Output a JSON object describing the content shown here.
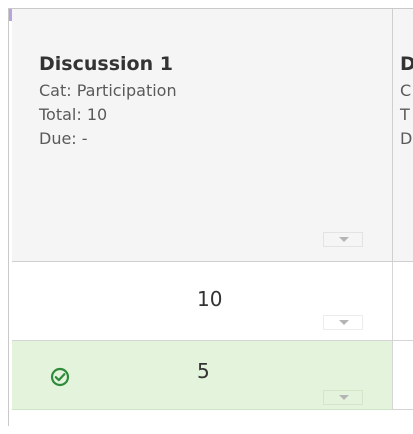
{
  "columns": [
    {
      "title": "Discussion 1",
      "category": "Cat: Participation",
      "total": "Total: 10",
      "due": "Due: -"
    },
    {
      "title": "D",
      "category": "C",
      "total": "T",
      "due": "D"
    }
  ],
  "rows": [
    {
      "score": "10",
      "status_icon": ""
    },
    {
      "score": "5",
      "status_icon": "check-circle-icon",
      "highlight": "#e4f3dc"
    }
  ],
  "colors": {
    "accent": "#b9a3de",
    "check": "#2f8a3a",
    "highlight_row": "#e4f3dc"
  }
}
